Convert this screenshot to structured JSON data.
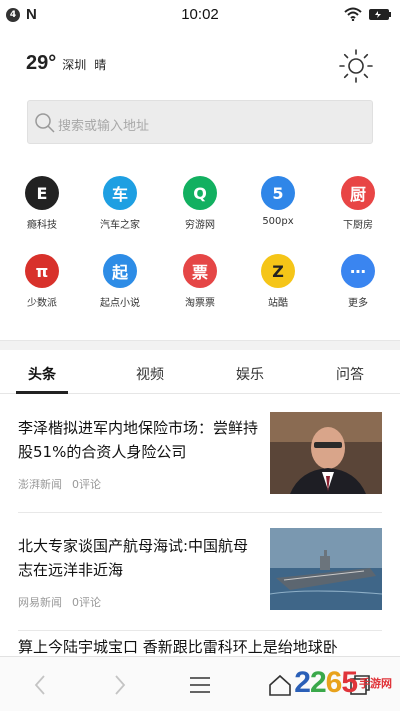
{
  "status_bar": {
    "notification_count": "4",
    "app_badge": "N",
    "time": "10:02",
    "icons": [
      "wifi-icon",
      "battery-icon"
    ]
  },
  "weather": {
    "temperature": "29°",
    "city": "深圳",
    "condition": "晴",
    "icon": "sun-icon"
  },
  "search": {
    "placeholder": "搜索或输入地址",
    "icon": "search-icon"
  },
  "apps": [
    {
      "label": "瘾科技",
      "glyph": "E",
      "color": "#222222"
    },
    {
      "label": "汽车之家",
      "glyph": "车",
      "color": "#1e9fe2"
    },
    {
      "label": "穷游网",
      "glyph": "Q",
      "color": "#12b060"
    },
    {
      "label": "500px",
      "glyph": "5",
      "color": "#2f86e8"
    },
    {
      "label": "下厨房",
      "glyph": "厨",
      "color": "#e84545"
    },
    {
      "label": "少数派",
      "glyph": "π",
      "color": "#d8312b"
    },
    {
      "label": "起点小说",
      "glyph": "起",
      "color": "#2d8ce6"
    },
    {
      "label": "淘票票",
      "glyph": "票",
      "color": "#e54646"
    },
    {
      "label": "站酷",
      "glyph": "Z",
      "color": "#f5c518"
    },
    {
      "label": "更多",
      "glyph": "⋯",
      "color": "#3a85f0"
    }
  ],
  "tabs": [
    {
      "label": "头条",
      "active": true
    },
    {
      "label": "视频",
      "active": false
    },
    {
      "label": "娱乐",
      "active": false
    },
    {
      "label": "问答",
      "active": false
    }
  ],
  "news": [
    {
      "title": "李泽楷拟进军内地保险市场：尝鲜持股51%的合资人身险公司",
      "source": "澎湃新闻",
      "comments": "0评论"
    },
    {
      "title": "北大专家谈国产航母海试:中国航母志在远洋非近海",
      "source": "网易新闻",
      "comments": "0评论"
    }
  ],
  "peek_title": "算上今陆宇城宝口 香新跟比雷科环上是绐地球卧",
  "bottom_nav": {
    "icons": [
      "back-icon",
      "forward-icon",
      "menu-icon",
      "home-icon",
      "tabs-icon"
    ]
  },
  "watermark": {
    "digits": [
      "2",
      "2",
      "6",
      "5"
    ],
    "digit_colors": [
      "#2a5fb7",
      "#3aa84a",
      "#e8a21c",
      "#e0343a"
    ],
    "site": "手游网"
  }
}
